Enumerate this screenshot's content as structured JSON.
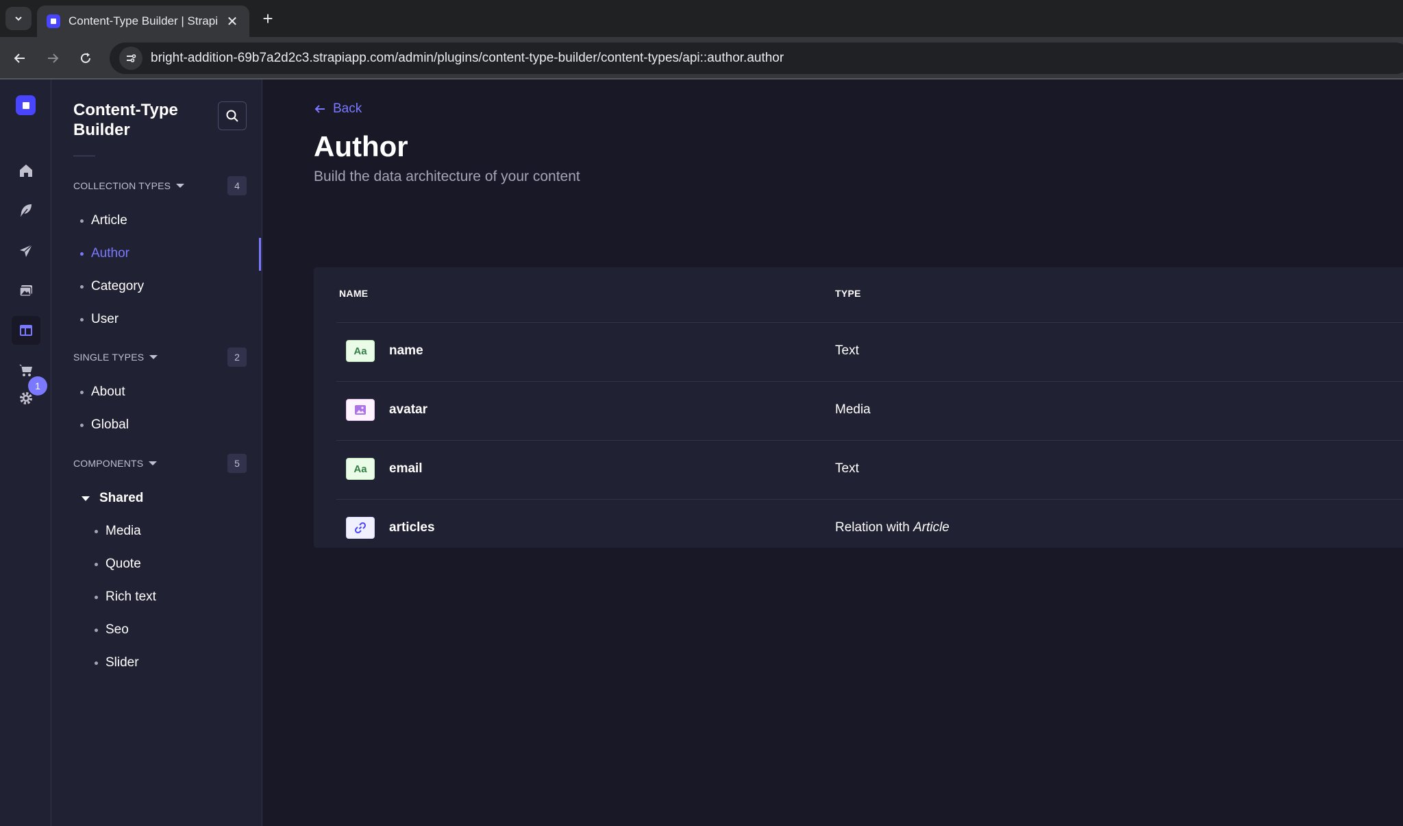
{
  "browser": {
    "tab_title": "Content-Type Builder | Strapi",
    "url": "bright-addition-69b7a2d2c3.strapiapp.com/admin/plugins/content-type-builder/content-types/api::author.author"
  },
  "rail": {
    "notification_count": "1"
  },
  "subnav": {
    "title": "Content-Type Builder",
    "sections": {
      "collection_types": {
        "label": "COLLECTION TYPES",
        "count": "4",
        "items": [
          "Article",
          "Author",
          "Category",
          "User"
        ],
        "active": "Author"
      },
      "single_types": {
        "label": "SINGLE TYPES",
        "count": "2",
        "items": [
          "About",
          "Global"
        ]
      },
      "components": {
        "label": "COMPONENTS",
        "count": "5",
        "group": "Shared",
        "items": [
          "Media",
          "Quote",
          "Rich text",
          "Seo",
          "Slider"
        ]
      }
    }
  },
  "main": {
    "back_label": "Back",
    "title": "Author",
    "subtitle": "Build the data architecture of your content",
    "table": {
      "headers": {
        "name": "NAME",
        "type": "TYPE"
      },
      "rows": [
        {
          "name": "name",
          "type": "Text",
          "icon": "text-icon",
          "icon_text": "Aa"
        },
        {
          "name": "avatar",
          "type": "Media",
          "icon": "media-icon"
        },
        {
          "name": "email",
          "type": "Text",
          "icon": "text-icon",
          "icon_text": "Aa"
        },
        {
          "name": "articles",
          "type_prefix": "Relation with",
          "type_target": "Article",
          "icon": "relation-icon"
        }
      ]
    }
  },
  "colors": {
    "accent": "#7b79ff",
    "brand": "#4945ff",
    "background": "#181826",
    "panel": "#212134"
  }
}
